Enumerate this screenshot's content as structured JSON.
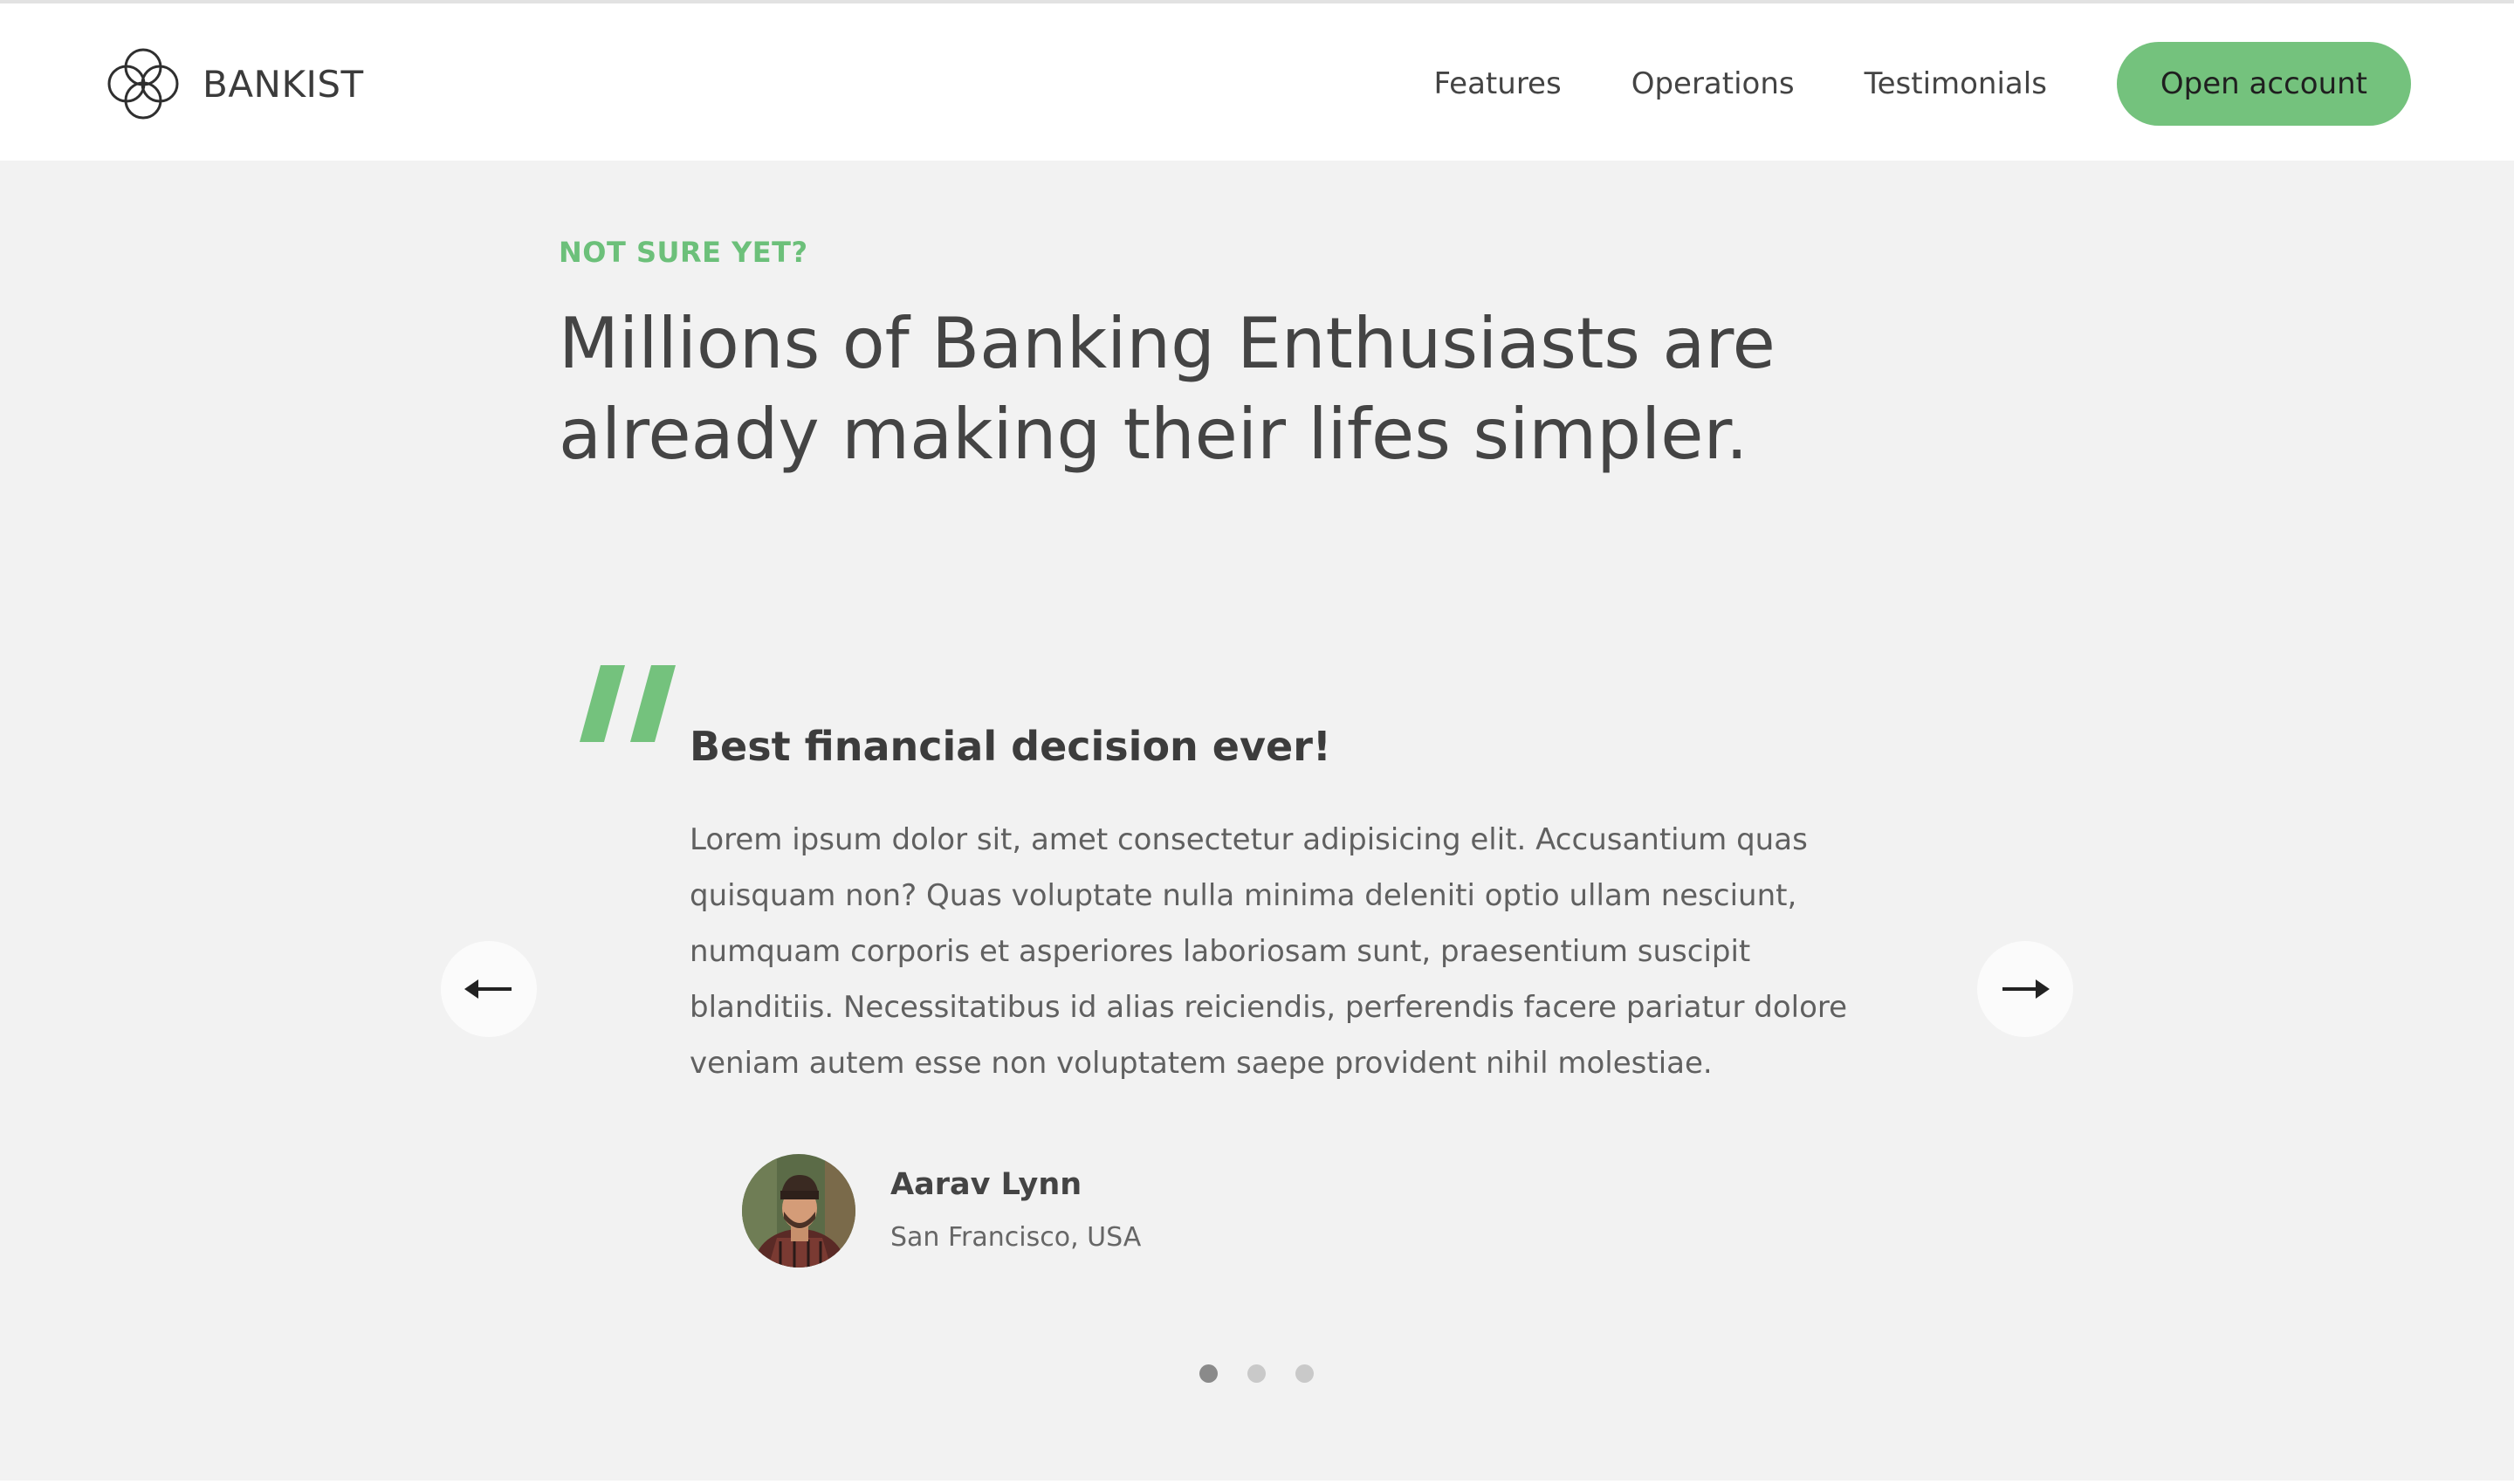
{
  "header": {
    "brand": "BANKIST",
    "logo_icon": "four-petal-flower-icon",
    "nav": [
      {
        "label": "Features"
      },
      {
        "label": "Operations"
      },
      {
        "label": "Testimonials"
      }
    ],
    "cta_label": "Open account",
    "accent_color": "#74c27d"
  },
  "section": {
    "eyebrow": "NOT SURE YET?",
    "headline": "Millions of Banking Enthusiasts are already making their lifes simpler."
  },
  "testimonial": {
    "quote_icon": "quote-mark-icon",
    "title": "Best financial decision ever!",
    "body": "Lorem ipsum dolor sit, amet consectetur adipisicing elit. Accusantium quas quisquam non? Quas voluptate nulla minima deleniti optio ullam nesciunt, numquam corporis et asperiores laboriosam sunt, praesentium suscipit blanditiis. Necessitatibus id alias reiciendis, perferendis facere pariatur dolore veniam autem esse non voluptatem saepe provident nihil molestiae.",
    "author_name": "Aarav Lynn",
    "author_location": "San Francisco, USA"
  },
  "slider": {
    "prev_icon": "arrow-left-icon",
    "next_icon": "arrow-right-icon",
    "slide_count": 3,
    "active_slide": 1
  }
}
